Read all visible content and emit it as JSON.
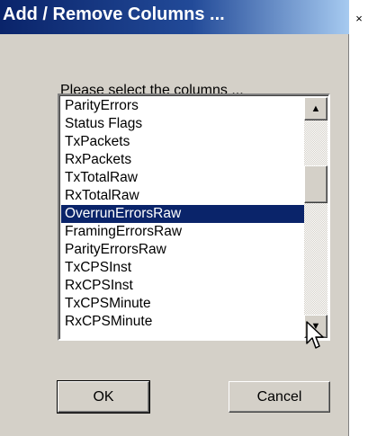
{
  "window": {
    "title": "Add / Remove Columns ...",
    "close_glyph": "×"
  },
  "prompt": "Please select the columns ...",
  "list": {
    "items": [
      "ParityErrors",
      "Status Flags",
      "TxPackets",
      "RxPackets",
      "TxTotalRaw",
      "RxTotalRaw",
      "OverrunErrorsRaw",
      "FramingErrorsRaw",
      "ParityErrorsRaw",
      "TxCPSInst",
      "RxCPSInst",
      "TxCPSMinute",
      "RxCPSMinute"
    ],
    "selected_item": "OverrunErrorsRaw"
  },
  "scrollbar": {
    "up_glyph": "▲",
    "down_glyph": "▼"
  },
  "buttons": {
    "ok_label": "OK",
    "cancel_label": "Cancel"
  },
  "colors": {
    "titlebar_start": "#0a246a",
    "titlebar_end": "#a6caf0",
    "selection": "#0a246a",
    "dialog_face": "#d4d0c8"
  }
}
